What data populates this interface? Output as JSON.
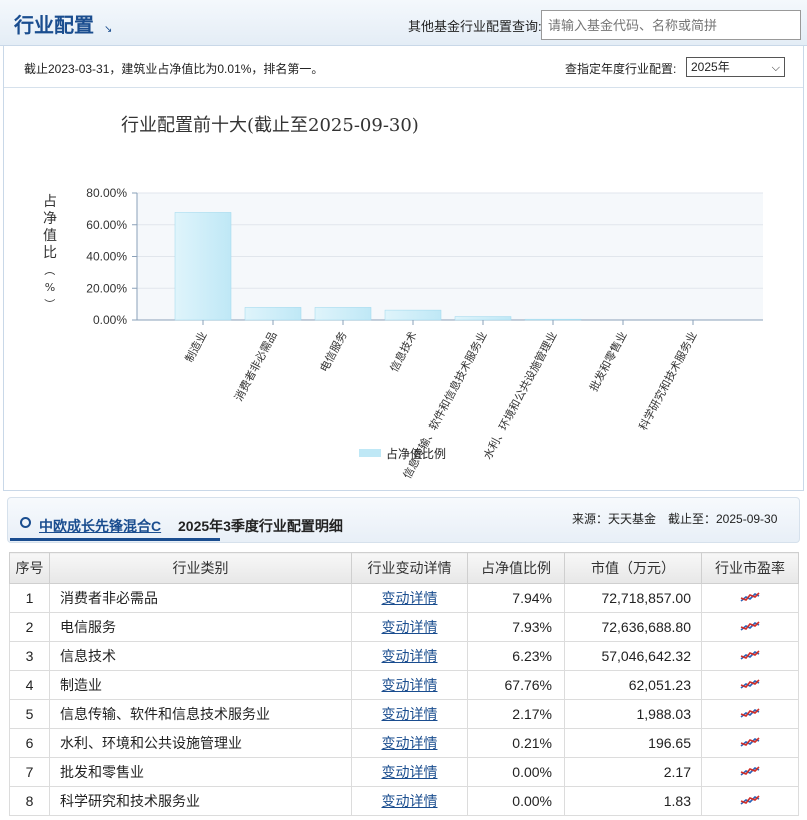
{
  "header": {
    "title": "行业配置",
    "query_label": "其他基金行业配置查询:",
    "search_placeholder": "请输入基金代码、名称或简拼"
  },
  "summary": {
    "note": "截止2023-03-31，建筑业占净值比为0.01%，排名第一。",
    "year_label": "查指定年度行业配置:",
    "year_selected": "2025年"
  },
  "chart_data": {
    "type": "bar",
    "title": "行业配置前十大(截止至2025-09-30)",
    "ylabel": "占净值比（%）",
    "ylim": [
      0,
      80
    ],
    "yticks": [
      "0.00%",
      "20.00%",
      "40.00%",
      "60.00%",
      "80.00%"
    ],
    "categories": [
      "制造业",
      "消费者非必需品",
      "电信服务",
      "信息技术",
      "信息传输、软件和信息技术服务业",
      "水利、环境和公共设施管理业",
      "批发和零售业",
      "科学研究和技术服务业"
    ],
    "series": [
      {
        "name": "占净值比例",
        "values": [
          67.76,
          7.94,
          7.93,
          6.23,
          2.17,
          0.21,
          0.0,
          0.0
        ]
      }
    ],
    "legend": "bottom-center",
    "grid": true,
    "colors": {
      "bar": "#bfe8f6",
      "bar_edge": "#9dd7ec"
    }
  },
  "detail": {
    "fund_name": "中欧成长先锋混合C",
    "title": "2025年3季度行业配置明细",
    "source": "来源：天天基金　截止至：2025-09-30",
    "columns": [
      "序号",
      "行业类别",
      "行业变动详情",
      "占净值比例",
      "市值（万元）",
      "行业市盈率"
    ],
    "rows": [
      {
        "idx": "1",
        "industry": "消费者非必需品",
        "link": "变动详情",
        "pct": "7.94%",
        "mv": "72,718,857.00"
      },
      {
        "idx": "2",
        "industry": "电信服务",
        "link": "变动详情",
        "pct": "7.93%",
        "mv": "72,636,688.80"
      },
      {
        "idx": "3",
        "industry": "信息技术",
        "link": "变动详情",
        "pct": "6.23%",
        "mv": "57,046,642.32"
      },
      {
        "idx": "4",
        "industry": "制造业",
        "link": "变动详情",
        "pct": "67.76%",
        "mv": "62,051.23"
      },
      {
        "idx": "5",
        "industry": "信息传输、软件和信息技术服务业",
        "link": "变动详情",
        "pct": "2.17%",
        "mv": "1,988.03"
      },
      {
        "idx": "6",
        "industry": "水利、环境和公共设施管理业",
        "link": "变动详情",
        "pct": "0.21%",
        "mv": "196.65"
      },
      {
        "idx": "7",
        "industry": "批发和零售业",
        "link": "变动详情",
        "pct": "0.00%",
        "mv": "2.17"
      },
      {
        "idx": "8",
        "industry": "科学研究和技术服务业",
        "link": "变动详情",
        "pct": "0.00%",
        "mv": "1.83"
      }
    ]
  }
}
